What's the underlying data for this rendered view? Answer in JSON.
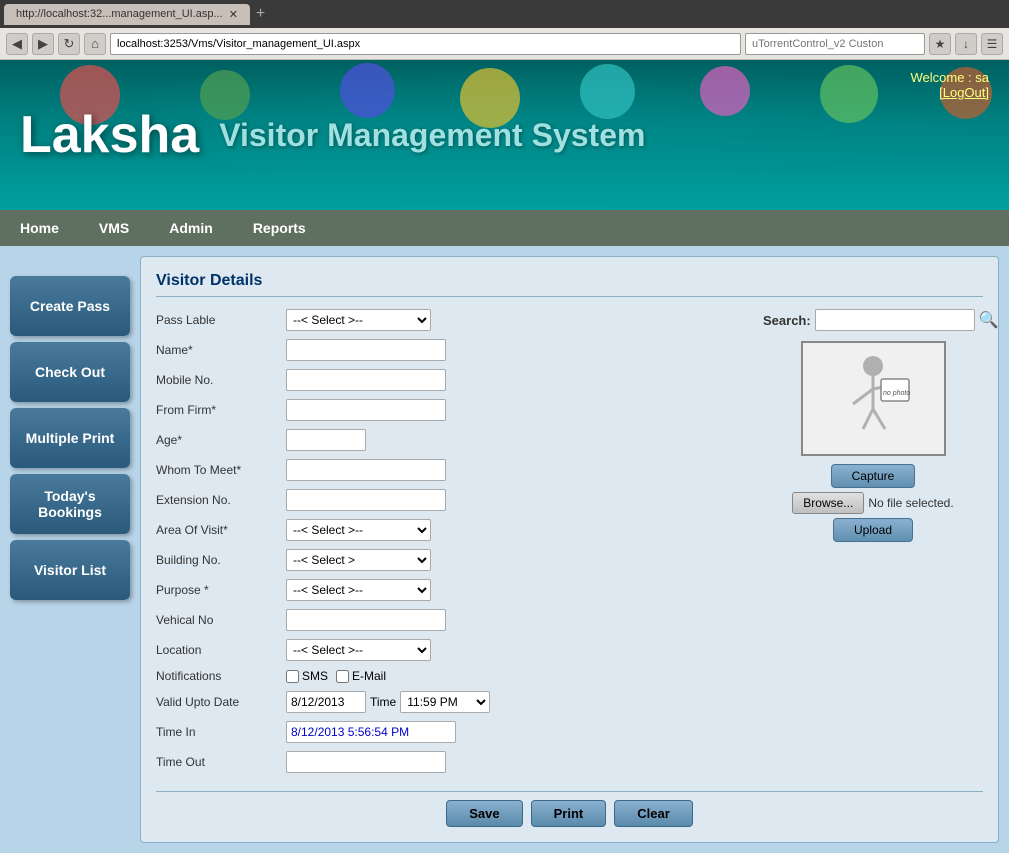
{
  "browser": {
    "tab_title": "http://localhost:32...management_UI.asp...",
    "url": "localhost:3253/Vms/Visitor_management_UI.aspx",
    "search_placeholder": "uTorrentControl_v2 Custon"
  },
  "header": {
    "title": "Laksha",
    "subtitle": "Visitor Management System",
    "welcome": "Welcome :  sa",
    "logout": "[LogOut]"
  },
  "nav": {
    "items": [
      "Home",
      "VMS",
      "Admin",
      "Reports"
    ]
  },
  "sidebar": {
    "buttons": [
      "Create Pass",
      "Check Out",
      "Multiple Print",
      "Today's Bookings",
      "Visitor List"
    ]
  },
  "form": {
    "title": "Visitor Details",
    "search_label": "Search:",
    "fields": {
      "pass_label": "Pass Lable",
      "pass_placeholder": "--< Select >--",
      "name_label": "Name*",
      "mobile_label": "Mobile No.",
      "from_firm_label": "From Firm*",
      "age_label": "Age*",
      "whom_to_meet_label": "Whom To Meet*",
      "extension_label": "Extension No.",
      "area_of_visit_label": "Area Of Visit*",
      "area_placeholder": "--< Select >--",
      "building_label": "Building No.",
      "building_placeholder": "--< Select >",
      "purpose_label": "Purpose *",
      "purpose_placeholder": "--< Select >--",
      "vehicle_label": "Vehical No",
      "location_label": "Location",
      "location_placeholder": "--< Select >--",
      "notifications_label": "Notifications",
      "sms_label": "SMS",
      "email_label": "E-Mail",
      "valid_upto_label": "Valid Upto Date",
      "valid_date": "8/12/2013",
      "time_label": "Time",
      "time_value": "11:59 PM",
      "time_in_label": "Time In",
      "time_in_value": "8/12/2013 5:56:54 PM",
      "time_out_label": "Time Out"
    },
    "photo": {
      "no_photo_text": "no photo",
      "capture_btn": "Capture",
      "browse_btn": "Browse...",
      "no_file_text": "No file selected.",
      "upload_btn": "Upload"
    },
    "buttons": {
      "save": "Save",
      "print": "Print",
      "clear": "Clear"
    }
  }
}
